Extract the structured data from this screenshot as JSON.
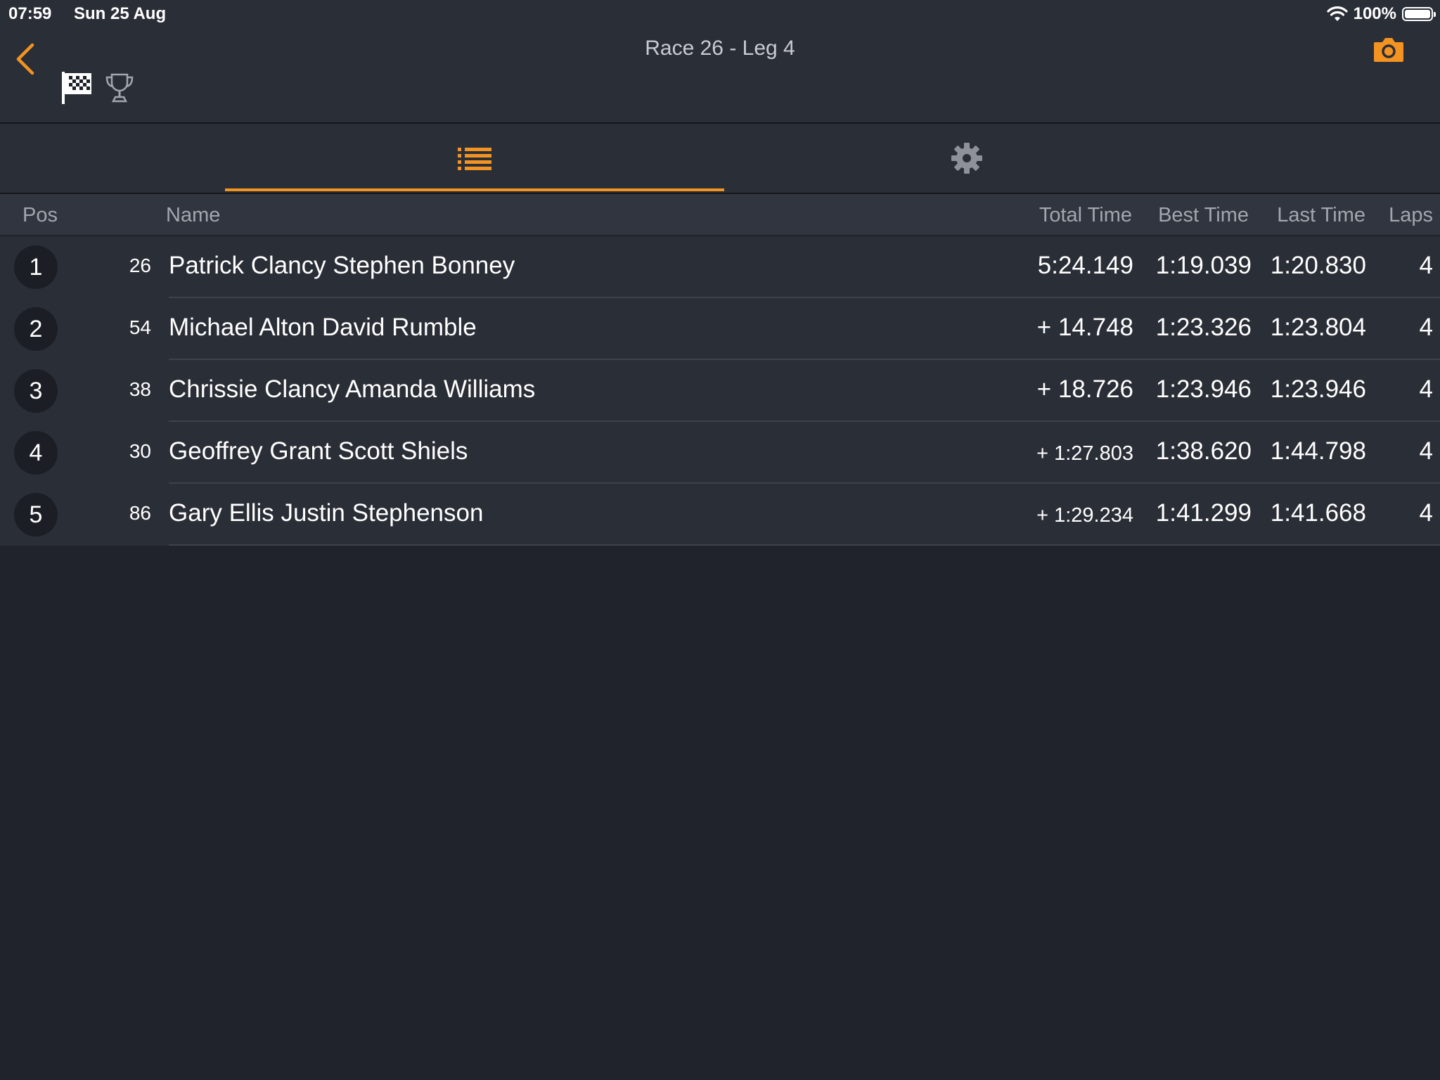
{
  "status_bar": {
    "time": "07:59",
    "date": "Sun 25 Aug",
    "battery": "100%"
  },
  "header": {
    "title": "Race 26 - Leg 4"
  },
  "colors": {
    "accent": "#f39322",
    "background": "#20232b",
    "panel": "#2a2e37",
    "header_row": "#31353f"
  },
  "icons": {
    "back": "chevron-left-icon",
    "flag": "checkered-flag-icon",
    "trophy": "trophy-icon",
    "camera": "camera-icon",
    "list": "list-icon",
    "settings": "gear-icon"
  },
  "tabs": [
    {
      "name": "list",
      "selected": true
    },
    {
      "name": "settings",
      "selected": false
    }
  ],
  "table": {
    "columns": {
      "pos": "Pos",
      "name": "Name",
      "total": "Total Time",
      "best": "Best Time",
      "last": "Last Time",
      "laps": "Laps"
    },
    "rows": [
      {
        "pos": "1",
        "number": "26",
        "name": "Patrick Clancy Stephen Bonney",
        "total": "5:24.149",
        "best": "1:19.039",
        "last": "1:20.830",
        "laps": "4"
      },
      {
        "pos": "2",
        "number": "54",
        "name": "Michael Alton David Rumble",
        "total": "+ 14.748",
        "best": "1:23.326",
        "last": "1:23.804",
        "laps": "4"
      },
      {
        "pos": "3",
        "number": "38",
        "name": "Chrissie Clancy Amanda Williams",
        "total": "+ 18.726",
        "best": "1:23.946",
        "last": "1:23.946",
        "laps": "4"
      },
      {
        "pos": "4",
        "number": "30",
        "name": "Geoffrey Grant Scott Shiels",
        "total": "+ 1:27.803",
        "best": "1:38.620",
        "last": "1:44.798",
        "laps": "4"
      },
      {
        "pos": "5",
        "number": "86",
        "name": "Gary Ellis Justin Stephenson",
        "total": "+ 1:29.234",
        "best": "1:41.299",
        "last": "1:41.668",
        "laps": "4"
      }
    ]
  }
}
